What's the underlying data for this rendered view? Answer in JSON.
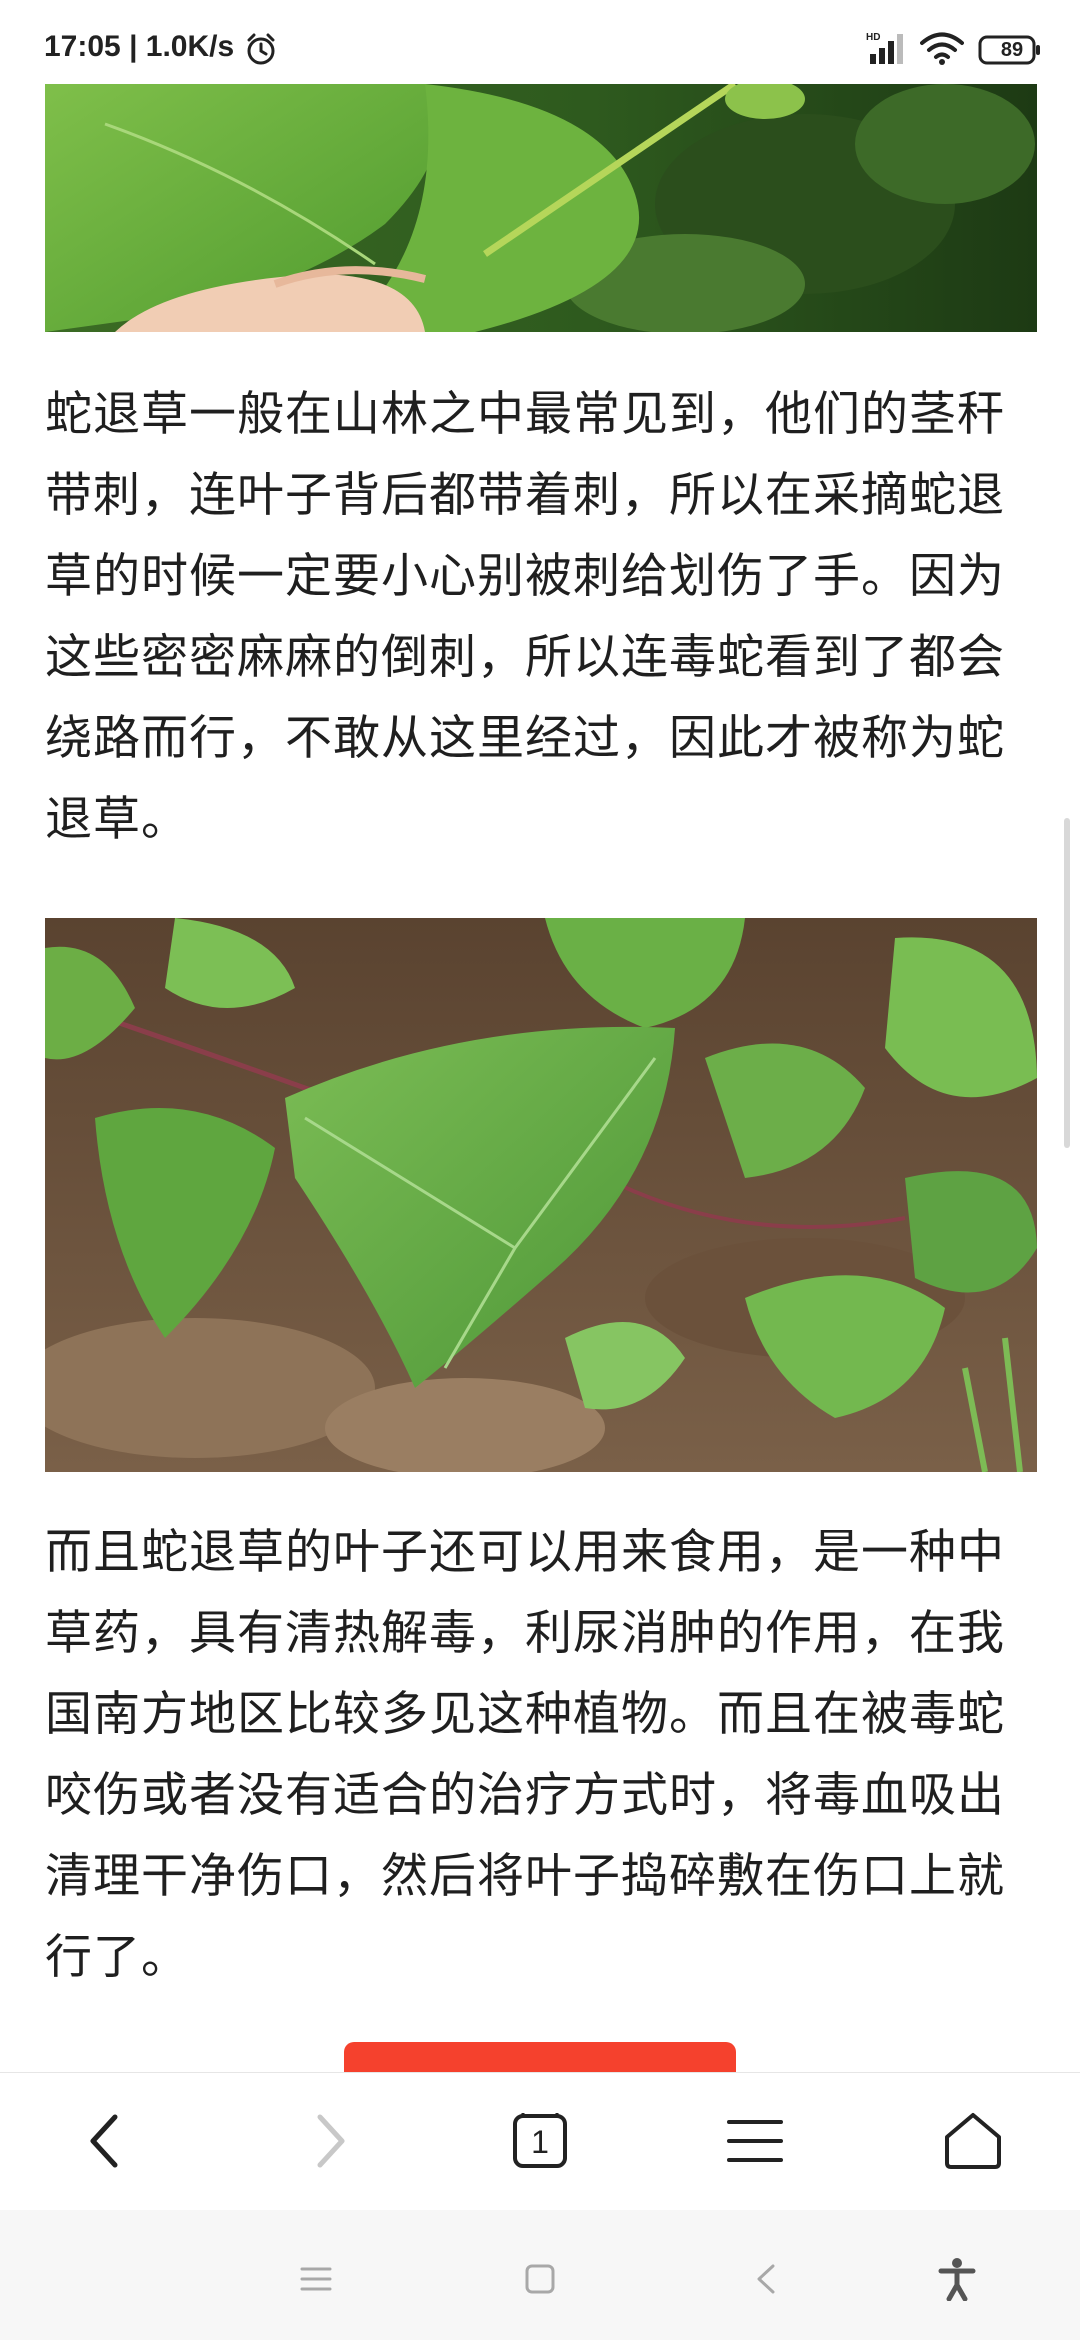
{
  "status_bar": {
    "time": "17:05 | 1.0K/s",
    "battery": "89",
    "icons": [
      "alarm-icon",
      "hd-signal-icon",
      "wifi-icon",
      "battery-icon"
    ]
  },
  "article": {
    "paragraph_1": "蛇退草一般在山林之中最常见到，他们的茎秆带刺，连叶子背后都带着刺，所以在采摘蛇退草的时候一定要小心别被刺给划伤了手。因为这些密密麻麻的倒刺，所以连毒蛇看到了都会绕路而行，不敢从这里经过，因此才被称为蛇退草。",
    "paragraph_2": "而且蛇退草的叶子还可以用来食用，是一种中草药，具有清热解毒，利尿消肿的作用，在我国南方地区比较多见这种植物。而且在被毒蛇咬伤或者没有适合的治疗方式时，将毒血吸出清理干净伤口，然后将叶子捣碎敷在伤口上就行了。"
  },
  "browser_toolbar": {
    "tab_count": "1",
    "icons": [
      "back-icon",
      "forward-icon",
      "tabs-icon",
      "menu-icon",
      "home-icon"
    ]
  },
  "system_nav": {
    "icons": [
      "recents-icon",
      "home-square-icon",
      "back-triangle-icon",
      "accessibility-icon"
    ]
  },
  "colors": {
    "accent_red": "#f5412d",
    "text": "#1f1f1f",
    "background": "#ffffff"
  }
}
